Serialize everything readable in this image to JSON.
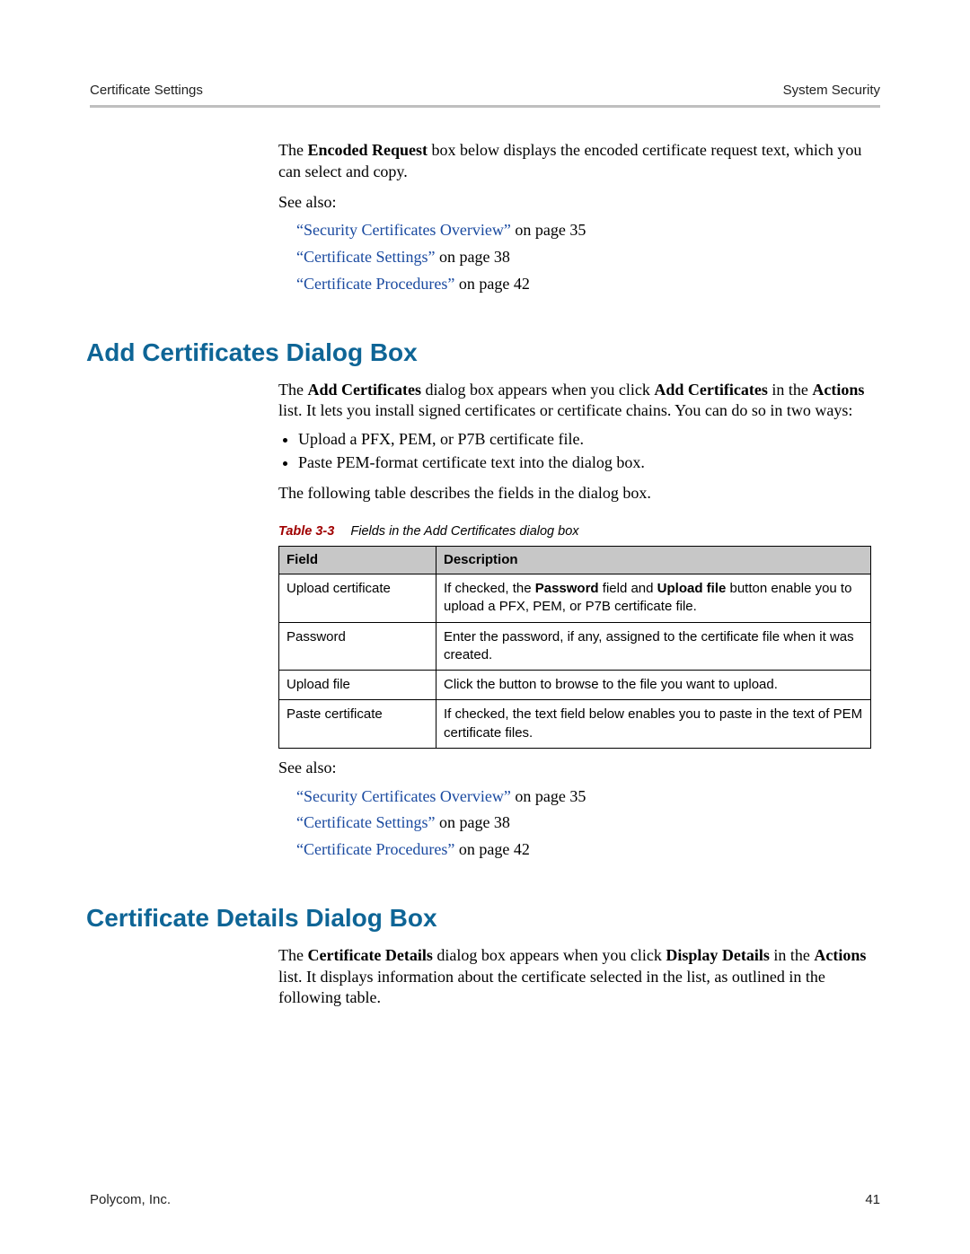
{
  "header": {
    "left": "Certificate Settings",
    "right": "System Security"
  },
  "intro": {
    "before_bold": "The ",
    "bold": "Encoded Request",
    "after_bold": " box below displays the encoded certificate request text, which you can select and copy."
  },
  "see_also_label": "See also:",
  "links1": [
    {
      "link": "“Security Certificates Overview”",
      "suffix": " on page 35"
    },
    {
      "link": "“Certificate Settings”",
      "suffix": " on page 38"
    },
    {
      "link": "“Certificate Procedures”",
      "suffix": " on page 42"
    }
  ],
  "section1": {
    "heading": "Add Certificates Dialog Box",
    "p1_a": "The ",
    "p1_b": "Add Certificates",
    "p1_c": " dialog box appears when you click ",
    "p1_d": "Add Certificates",
    "p1_e": " in the ",
    "p1_f": "Actions",
    "p1_g": " list. It lets you install signed certificates or certificate chains. You can do so in two ways:",
    "bullets": [
      "Upload a PFX, PEM, or P7B certificate file.",
      "Paste PEM-format certificate text into the dialog box."
    ],
    "p2": "The following table describes the fields in the dialog box."
  },
  "table": {
    "caption_label": "Table 3-3",
    "caption_text": "Fields in the Add Certificates dialog box",
    "col1": "Field",
    "col2": "Description",
    "rows": [
      {
        "field": "Upload certificate",
        "desc_a": "If checked, the ",
        "desc_b": "Password",
        "desc_c": " field and ",
        "desc_d": "Upload file",
        "desc_e": " button enable you to upload a PFX, PEM, or P7B certificate file."
      },
      {
        "field": "Password",
        "desc_a": "Enter the password, if any, assigned to the certificate file when it was created.",
        "desc_b": "",
        "desc_c": "",
        "desc_d": "",
        "desc_e": ""
      },
      {
        "field": "Upload file",
        "desc_a": "Click the button to browse to the file you want to upload.",
        "desc_b": "",
        "desc_c": "",
        "desc_d": "",
        "desc_e": ""
      },
      {
        "field": "Paste certificate",
        "desc_a": "If checked, the text field below enables you to paste in the text of PEM certificate files.",
        "desc_b": "",
        "desc_c": "",
        "desc_d": "",
        "desc_e": ""
      }
    ]
  },
  "links2": [
    {
      "link": "“Security Certificates Overview”",
      "suffix": " on page 35"
    },
    {
      "link": "“Certificate Settings”",
      "suffix": " on page 38"
    },
    {
      "link": "“Certificate Procedures”",
      "suffix": " on page 42"
    }
  ],
  "section2": {
    "heading": "Certificate Details Dialog Box",
    "p1_a": "The ",
    "p1_b": "Certificate Details",
    "p1_c": " dialog box appears when you click ",
    "p1_d": "Display Details",
    "p1_e": " in the ",
    "p1_f": "Actions",
    "p1_g": " list. It displays information about the certificate selected in the list, as outlined in the following table."
  },
  "footer": {
    "left": "Polycom, Inc.",
    "right": "41"
  }
}
